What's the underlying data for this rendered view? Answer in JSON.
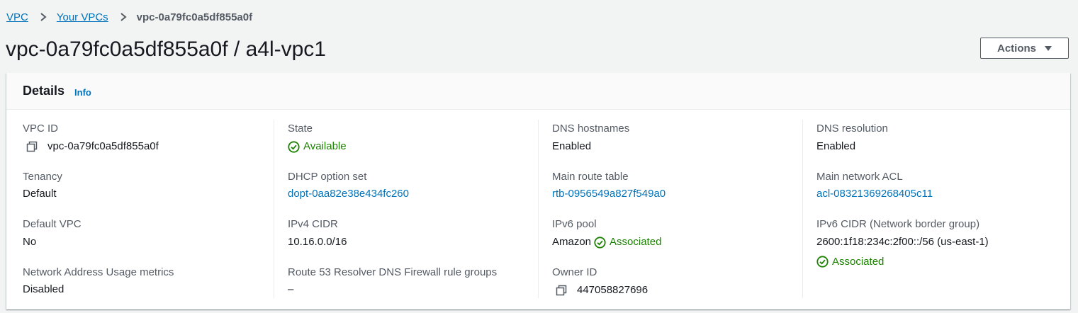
{
  "breadcrumb": {
    "items": [
      "VPC",
      "Your VPCs"
    ],
    "current": "vpc-0a79fc0a5df855a0f"
  },
  "page": {
    "title": "vpc-0a79fc0a5df855a0f / a4l-vpc1",
    "actions_label": "Actions"
  },
  "details": {
    "title": "Details",
    "info_label": "Info",
    "columns": [
      [
        {
          "label": "VPC ID",
          "value": "vpc-0a79fc0a5df855a0f",
          "copy": true
        },
        {
          "label": "Tenancy",
          "value": "Default"
        },
        {
          "label": "Default VPC",
          "value": "No"
        },
        {
          "label": "Network Address Usage metrics",
          "value": "Disabled"
        }
      ],
      [
        {
          "label": "State",
          "value": "Available",
          "status": "success"
        },
        {
          "label": "DHCP option set",
          "value": "dopt-0aa82e38e434fc260",
          "link": true
        },
        {
          "label": "IPv4 CIDR",
          "value": "10.16.0.0/16"
        },
        {
          "label": "Route 53 Resolver DNS Firewall rule groups",
          "value": "–"
        }
      ],
      [
        {
          "label": "DNS hostnames",
          "value": "Enabled"
        },
        {
          "label": "Main route table",
          "value": "rtb-0956549a827f549a0",
          "link": true
        },
        {
          "label": "IPv6 pool",
          "value": "Amazon",
          "status_text": "Associated"
        },
        {
          "label": "Owner ID",
          "value": "447058827696",
          "copy": true
        }
      ],
      [
        {
          "label": "DNS resolution",
          "value": "Enabled"
        },
        {
          "label": "Main network ACL",
          "value": "acl-08321369268405c11",
          "link": true
        },
        {
          "label": "IPv6 CIDR (Network border group)",
          "value": "2600:1f18:234c:2f00::/56 (us-east-1)",
          "status_text": "Associated"
        }
      ]
    ]
  },
  "colors": {
    "link": "#0073bb",
    "success": "#1d8102",
    "text": "#16191f",
    "label": "#545b64",
    "background": "#f2f3f3"
  },
  "icons": {
    "copy": "copy-icon",
    "status": "status-positive-icon",
    "breadcrumb_separator": "chevron-right-icon",
    "dropdown": "caret-down-icon"
  }
}
